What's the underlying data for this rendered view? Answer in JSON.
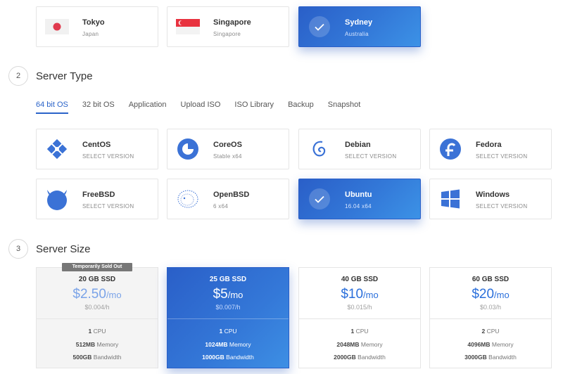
{
  "locations": [
    {
      "city": "Tokyo",
      "country": "Japan",
      "flag": "japan-flag-icon"
    },
    {
      "city": "Singapore",
      "country": "Singapore",
      "flag": "singapore-flag-icon"
    },
    {
      "city": "Sydney",
      "country": "Australia",
      "selected": true
    }
  ],
  "server_type": {
    "step": "2",
    "title": "Server Type",
    "tabs": [
      "64 bit OS",
      "32 bit OS",
      "Application",
      "Upload ISO",
      "ISO Library",
      "Backup",
      "Snapshot"
    ],
    "active_tab": "64 bit OS",
    "os": [
      {
        "name": "CentOS",
        "sub": "SELECT VERSION",
        "icon": "centos-icon"
      },
      {
        "name": "CoreOS",
        "sub": "Stable  x64",
        "icon": "coreos-icon"
      },
      {
        "name": "Debian",
        "sub": "SELECT VERSION",
        "icon": "debian-icon"
      },
      {
        "name": "Fedora",
        "sub": "SELECT VERSION",
        "icon": "fedora-icon"
      },
      {
        "name": "FreeBSD",
        "sub": "SELECT VERSION",
        "icon": "freebsd-icon"
      },
      {
        "name": "OpenBSD",
        "sub": "6  x64",
        "icon": "openbsd-icon"
      },
      {
        "name": "Ubuntu",
        "sub": "16.04  x64",
        "selected": true
      },
      {
        "name": "Windows",
        "sub": "SELECT VERSION",
        "icon": "windows-icon"
      }
    ]
  },
  "server_size": {
    "step": "3",
    "title": "Server Size",
    "sold_out_label": "Temporarily Sold Out",
    "plans": [
      {
        "storage": "20 GB SSD",
        "price": "$2.50",
        "per": "/mo",
        "hourly": "$0.004/h",
        "cpu": "1",
        "cpu_label": "CPU",
        "memory": "512MB",
        "memory_label": "Memory",
        "bandwidth": "500GB",
        "bandwidth_label": "Bandwidth",
        "sold_out": true
      },
      {
        "storage": "25 GB SSD",
        "price": "$5",
        "per": "/mo",
        "hourly": "$0.007/h",
        "cpu": "1",
        "cpu_label": "CPU",
        "memory": "1024MB",
        "memory_label": "Memory",
        "bandwidth": "1000GB",
        "bandwidth_label": "Bandwidth",
        "selected": true
      },
      {
        "storage": "40 GB SSD",
        "price": "$10",
        "per": "/mo",
        "hourly": "$0.015/h",
        "cpu": "1",
        "cpu_label": "CPU",
        "memory": "2048MB",
        "memory_label": "Memory",
        "bandwidth": "2000GB",
        "bandwidth_label": "Bandwidth"
      },
      {
        "storage": "60 GB SSD",
        "price": "$20",
        "per": "/mo",
        "hourly": "$0.03/h",
        "cpu": "2",
        "cpu_label": "CPU",
        "memory": "4096MB",
        "memory_label": "Memory",
        "bandwidth": "3000GB",
        "bandwidth_label": "Bandwidth"
      }
    ]
  },
  "colors": {
    "accent": "#2a63c9",
    "selected_gradient_start": "#2a5fc8",
    "selected_gradient_end": "#3c92e6",
    "sold_out_badge": "#777777"
  }
}
